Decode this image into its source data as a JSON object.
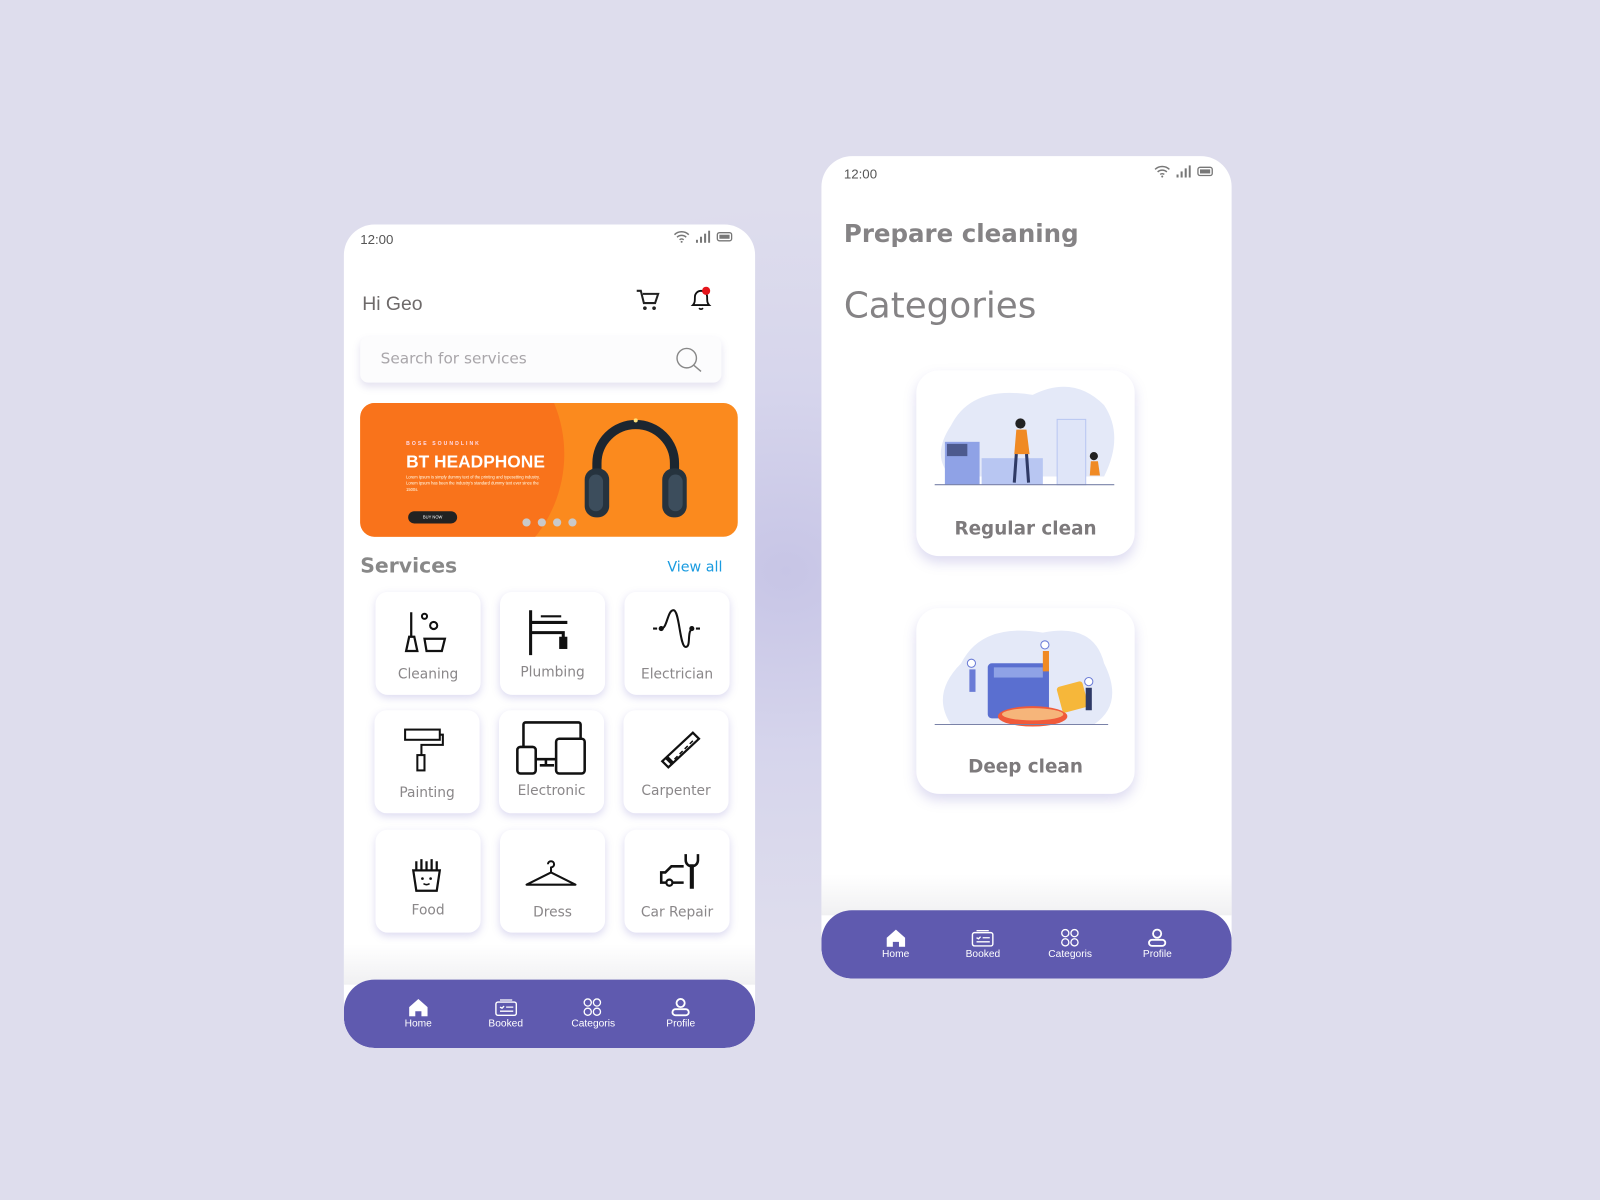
{
  "colors": {
    "background": "#dedded",
    "nav": "#5f5aaf",
    "link": "#1a9be0",
    "banner": "#fb8a1e",
    "notification_dot": "#e5141b"
  },
  "home": {
    "status_time": "12:00",
    "greeting": "Hi Geo",
    "search_placeholder": "Search for services",
    "banner": {
      "subtitle": "BOSE SOUNDLINK",
      "title": "BT HEADPHONE",
      "text": "Lorem Ipsum is simply dummy text of the printing and typesetting industry. Lorem Ipsum has been the industry's standard dummy text ever since the 1500s.",
      "button": "BUY NOW",
      "slides": 4
    },
    "services_title": "Services",
    "view_all": "View all",
    "services": [
      {
        "label": "Cleaning",
        "icon": "cleaning-icon"
      },
      {
        "label": "Plumbing",
        "icon": "faucet-icon"
      },
      {
        "label": "Electrician",
        "icon": "wire-icon"
      },
      {
        "label": "Painting",
        "icon": "paint-roller-icon"
      },
      {
        "label": "Electronic",
        "icon": "devices-icon"
      },
      {
        "label": "Carpenter",
        "icon": "saw-icon"
      },
      {
        "label": "Food",
        "icon": "fries-icon"
      },
      {
        "label": "Dress",
        "icon": "hanger-icon"
      },
      {
        "label": "Car Repair",
        "icon": "car-wrench-icon"
      }
    ]
  },
  "categories_screen": {
    "status_time": "12:00",
    "subtitle": "Prepare cleaning",
    "title": "Categories",
    "items": [
      {
        "label": "Regular clean"
      },
      {
        "label": "Deep clean"
      }
    ]
  },
  "nav": {
    "items": [
      {
        "label": "Home",
        "icon": "home-icon"
      },
      {
        "label": "Booked",
        "icon": "booked-icon"
      },
      {
        "label": "Categoris",
        "icon": "categories-icon"
      },
      {
        "label": "Profile",
        "icon": "profile-icon"
      }
    ]
  }
}
